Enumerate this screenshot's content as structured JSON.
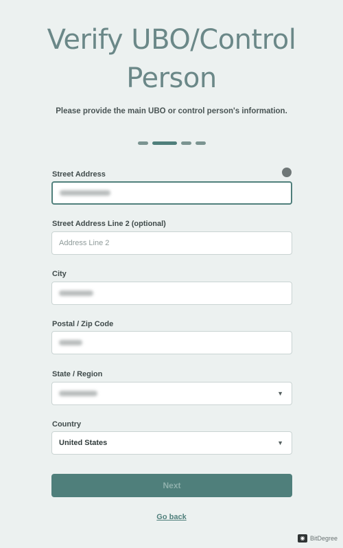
{
  "header": {
    "title_line1": "Verify UBO/Control",
    "title_line2": "Person",
    "subtitle": "Please provide the main UBO or control person's information."
  },
  "progress": {
    "total_steps": 4,
    "current_step": 2
  },
  "form": {
    "street_address": {
      "label": "Street Address",
      "value": "",
      "redacted": true
    },
    "street_address_2": {
      "label": "Street Address Line 2 (optional)",
      "placeholder": "Address Line 2",
      "value": ""
    },
    "city": {
      "label": "City",
      "value": "",
      "redacted": true
    },
    "postal_code": {
      "label": "Postal / Zip Code",
      "value": "",
      "redacted": true
    },
    "state_region": {
      "label": "State / Region",
      "value": "",
      "redacted": true
    },
    "country": {
      "label": "Country",
      "value": "United States"
    }
  },
  "actions": {
    "next_label": "Next",
    "go_back_label": "Go back"
  },
  "watermark": {
    "text": "BitDegree"
  },
  "colors": {
    "background": "#ecf1f0",
    "accent": "#4f7f7b",
    "title": "#6b8888"
  },
  "icons": {
    "info": "info-dot-icon",
    "dropdown": "chevron-down-icon"
  }
}
